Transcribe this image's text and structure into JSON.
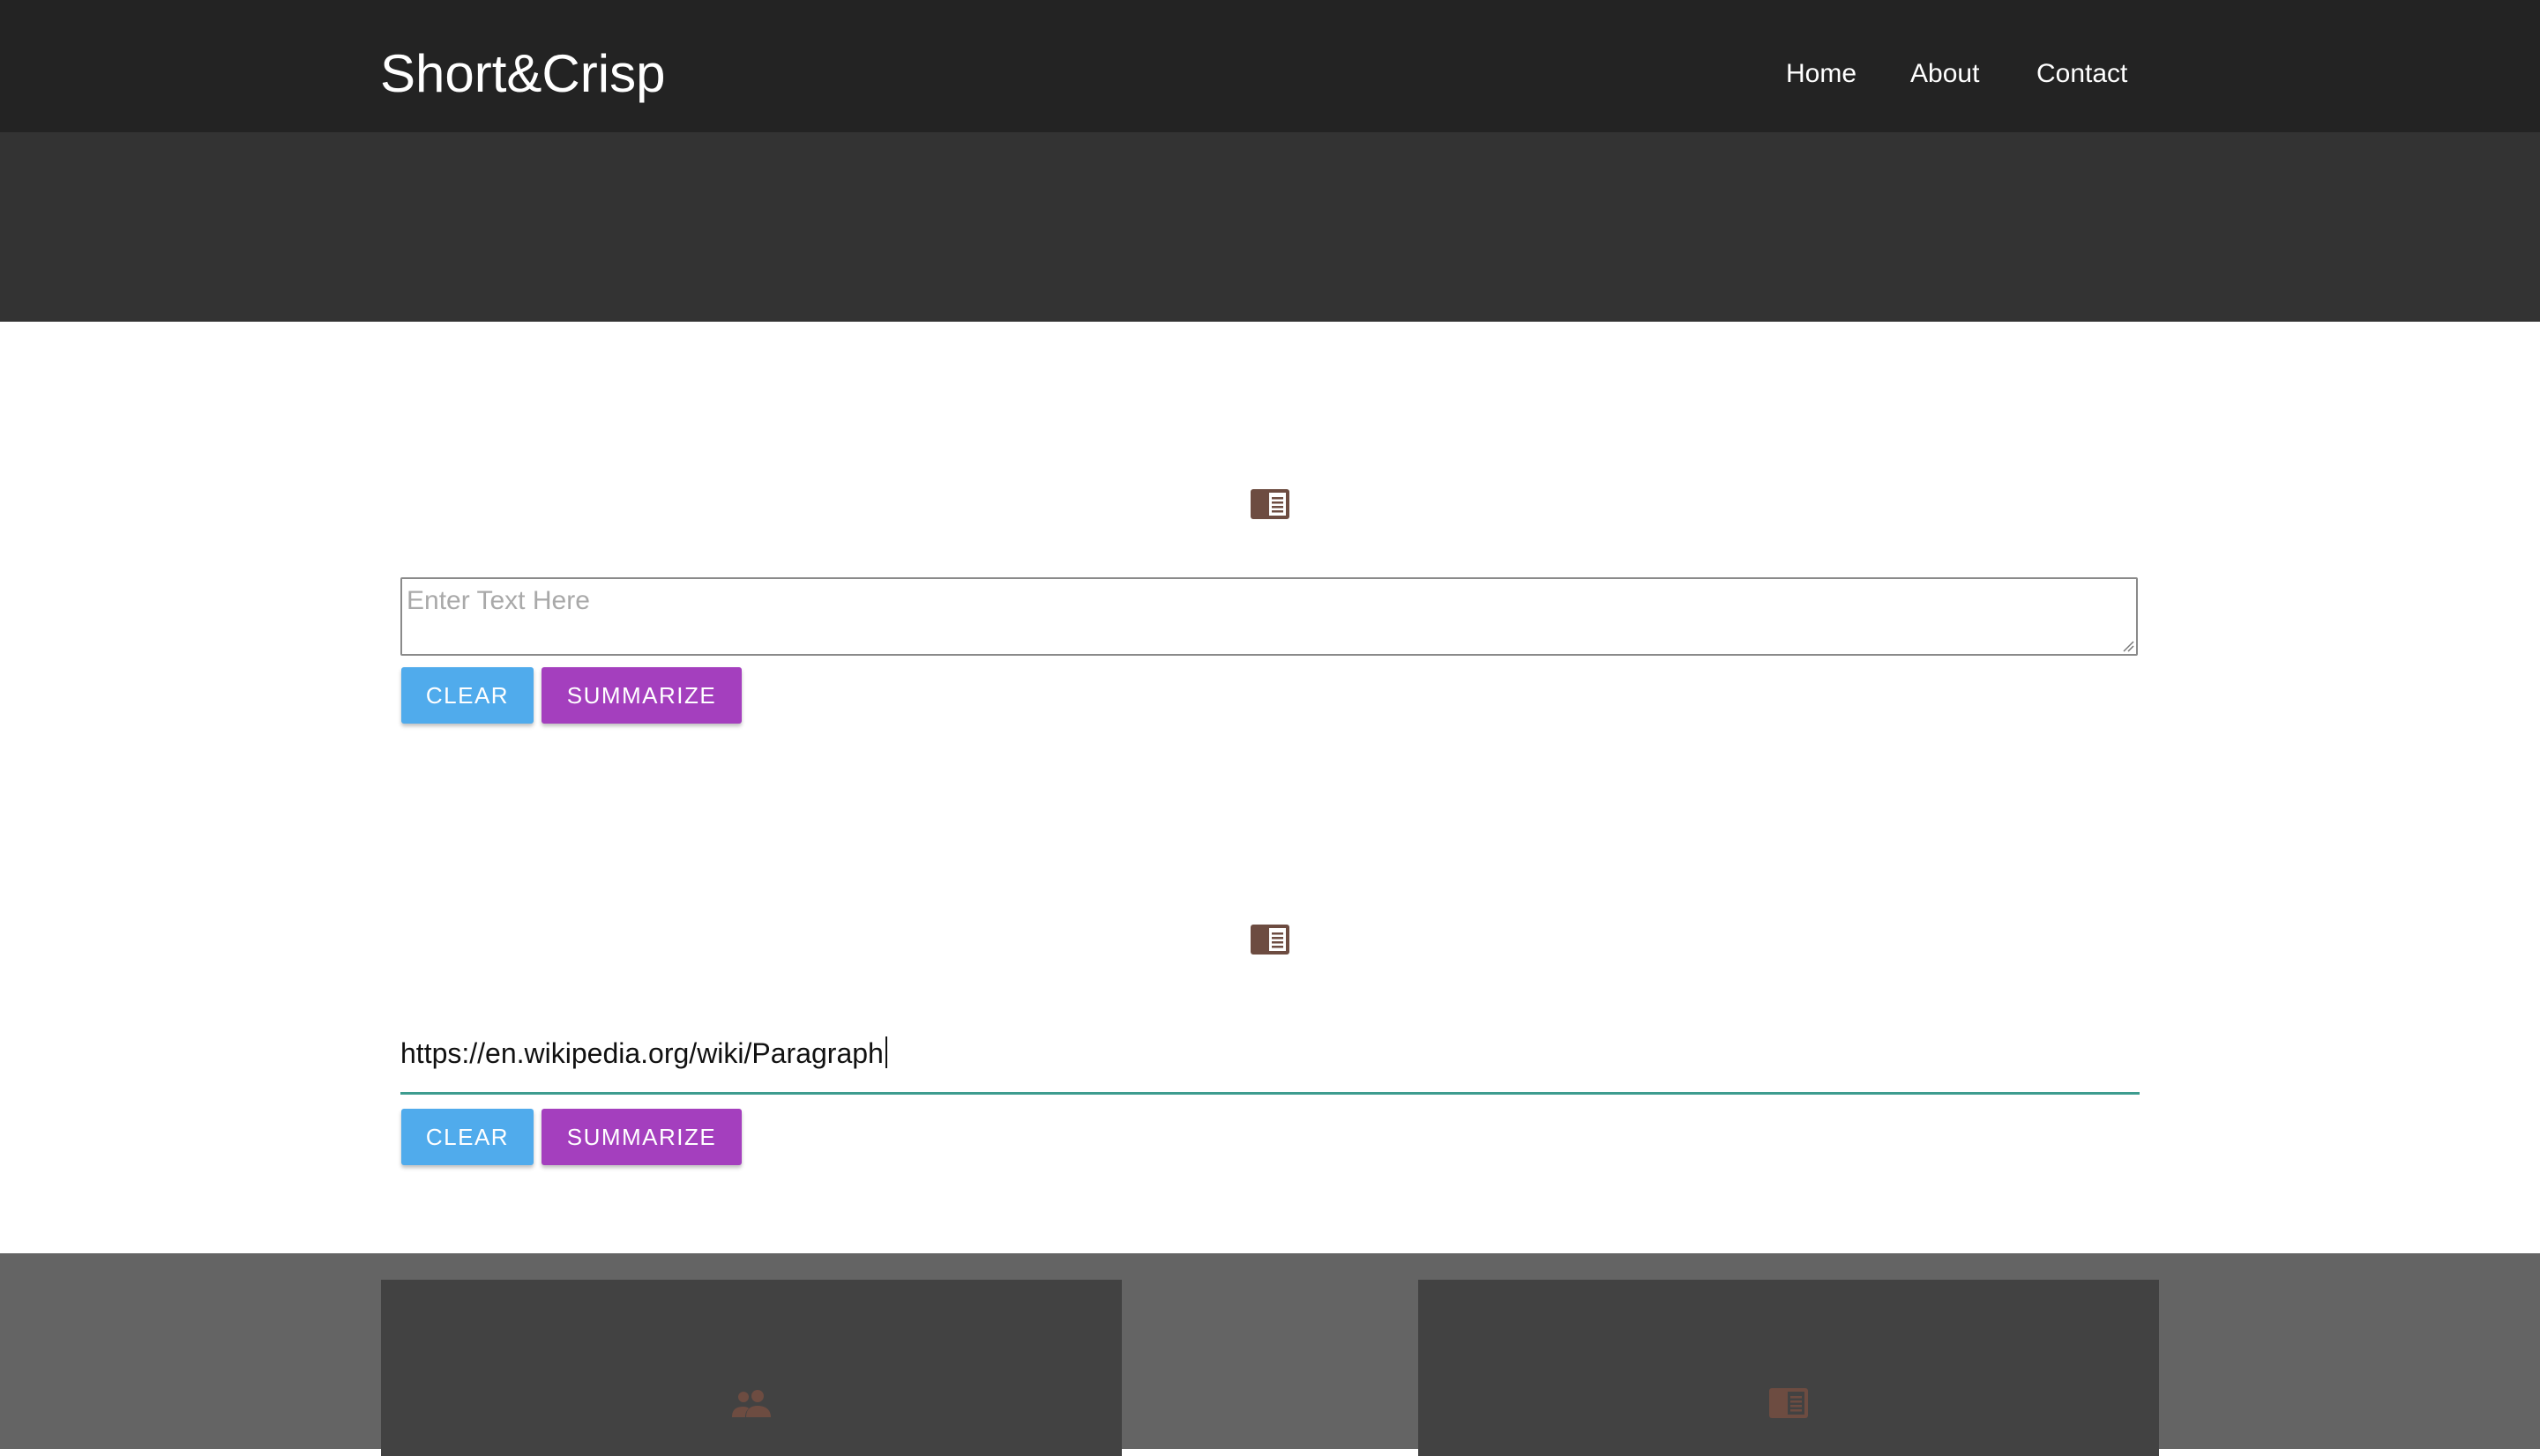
{
  "brand": {
    "name": "Short&Crisp"
  },
  "nav": {
    "home": "Home",
    "about": "About",
    "contact": "Contact"
  },
  "text_section": {
    "icon": "document-icon",
    "placeholder": "Enter Text Here",
    "clear_label": "CLEAR",
    "summarize_label": "SUMMARIZE"
  },
  "url_section": {
    "icon": "document-icon",
    "value": "https://en.wikipedia.org/wiki/Paragraph",
    "clear_label": "CLEAR",
    "summarize_label": "SUMMARIZE"
  },
  "footer": {
    "cards": [
      {
        "icon": "people-icon"
      },
      {
        "icon": "document-icon"
      }
    ]
  },
  "colors": {
    "navbar": "#232323",
    "hero": "#333333",
    "clear_button": "#50abec",
    "summarize_button": "#a43fbe",
    "url_underline": "#3d9c8f",
    "icon_brown": "#6d4c41",
    "footer": "#646464",
    "card": "#424242"
  }
}
